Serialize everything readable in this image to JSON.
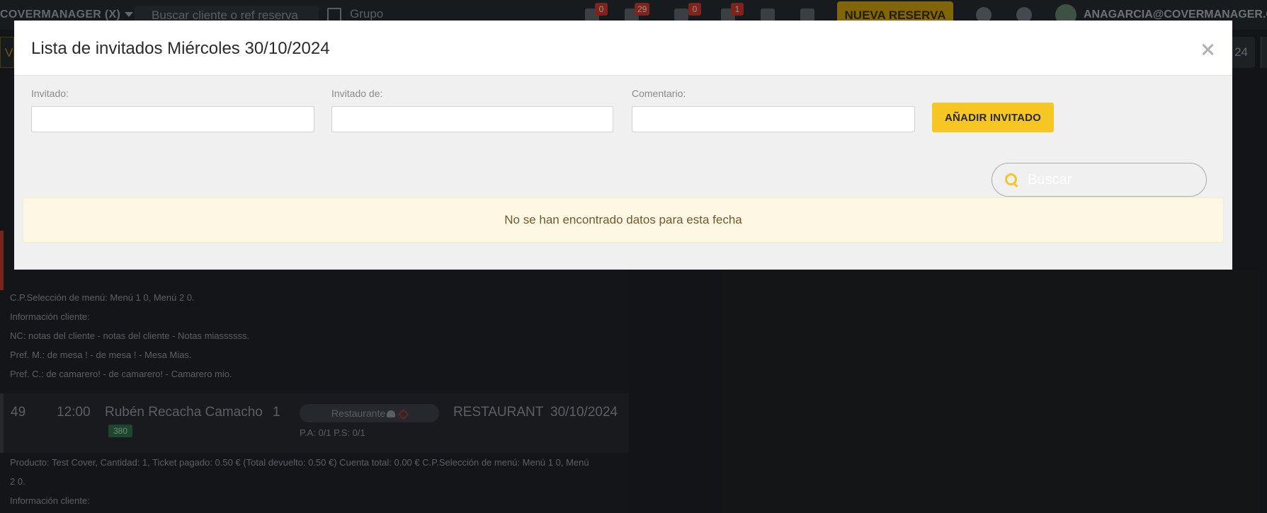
{
  "app": {
    "brand": "COVERMANAGER (X)",
    "search_placeholder": "Buscar cliente o ref reserva",
    "grupo_label": "Grupo",
    "badges": [
      "0",
      "29",
      "0",
      "1"
    ],
    "new_reservation_label": "NUEVA RESERVA",
    "user_email": "ANAGARCIA@COVERMANAGER.COM",
    "subbar_left_text": "V",
    "subbar_right_text": "24"
  },
  "notes_block": [
    "C.P.Selección de menú: Menú 1 0, Menú 2 0.",
    "Información cliente:",
    "NC: notas del cliente - notas del cliente - Notas miassssss.",
    "Pref. M.: de mesa ! - de mesa ! - Mesa Mias.",
    "Pref. C.: de camarero! - de camarero! - Camarero mio."
  ],
  "reservation": {
    "id": "49",
    "time": "12:00",
    "name": "Rubén Recacha Camacho",
    "pax": "1",
    "tag": "380",
    "zone_pill": "Restaurante",
    "pa_ps": "P.A: 0/1  P.S: 0/1",
    "area": "RESTAURANT",
    "date": "30/10/2024"
  },
  "reservation_notes": [
    "Producto: Test Cover, Cantidad: 1, Ticket pagado: 0.50 € (Total devuelto: 0.50 €) Cuenta total: 0.00 € C.P.Selección de menú: Menú 1 0, Menú",
    "2 0.",
    "Información cliente:"
  ],
  "modal": {
    "title": "Lista de invitados Miércoles 30/10/2024",
    "fields": {
      "invitado_label": "Invitado:",
      "invitado_value": "",
      "invitado_de_label": "Invitado de:",
      "invitado_de_value": "",
      "comentario_label": "Comentario:",
      "comentario_value": ""
    },
    "add_button_label": "AÑADIR INVITADO",
    "search_placeholder": "Buscar",
    "empty_message": "No se han encontrado datos para esta fecha",
    "colors": {
      "accent": "#f6c624",
      "alert_bg": "#fdf7e3",
      "alert_text": "#6e5a2e"
    },
    "icons": [
      "close-icon",
      "search-icon"
    ]
  }
}
